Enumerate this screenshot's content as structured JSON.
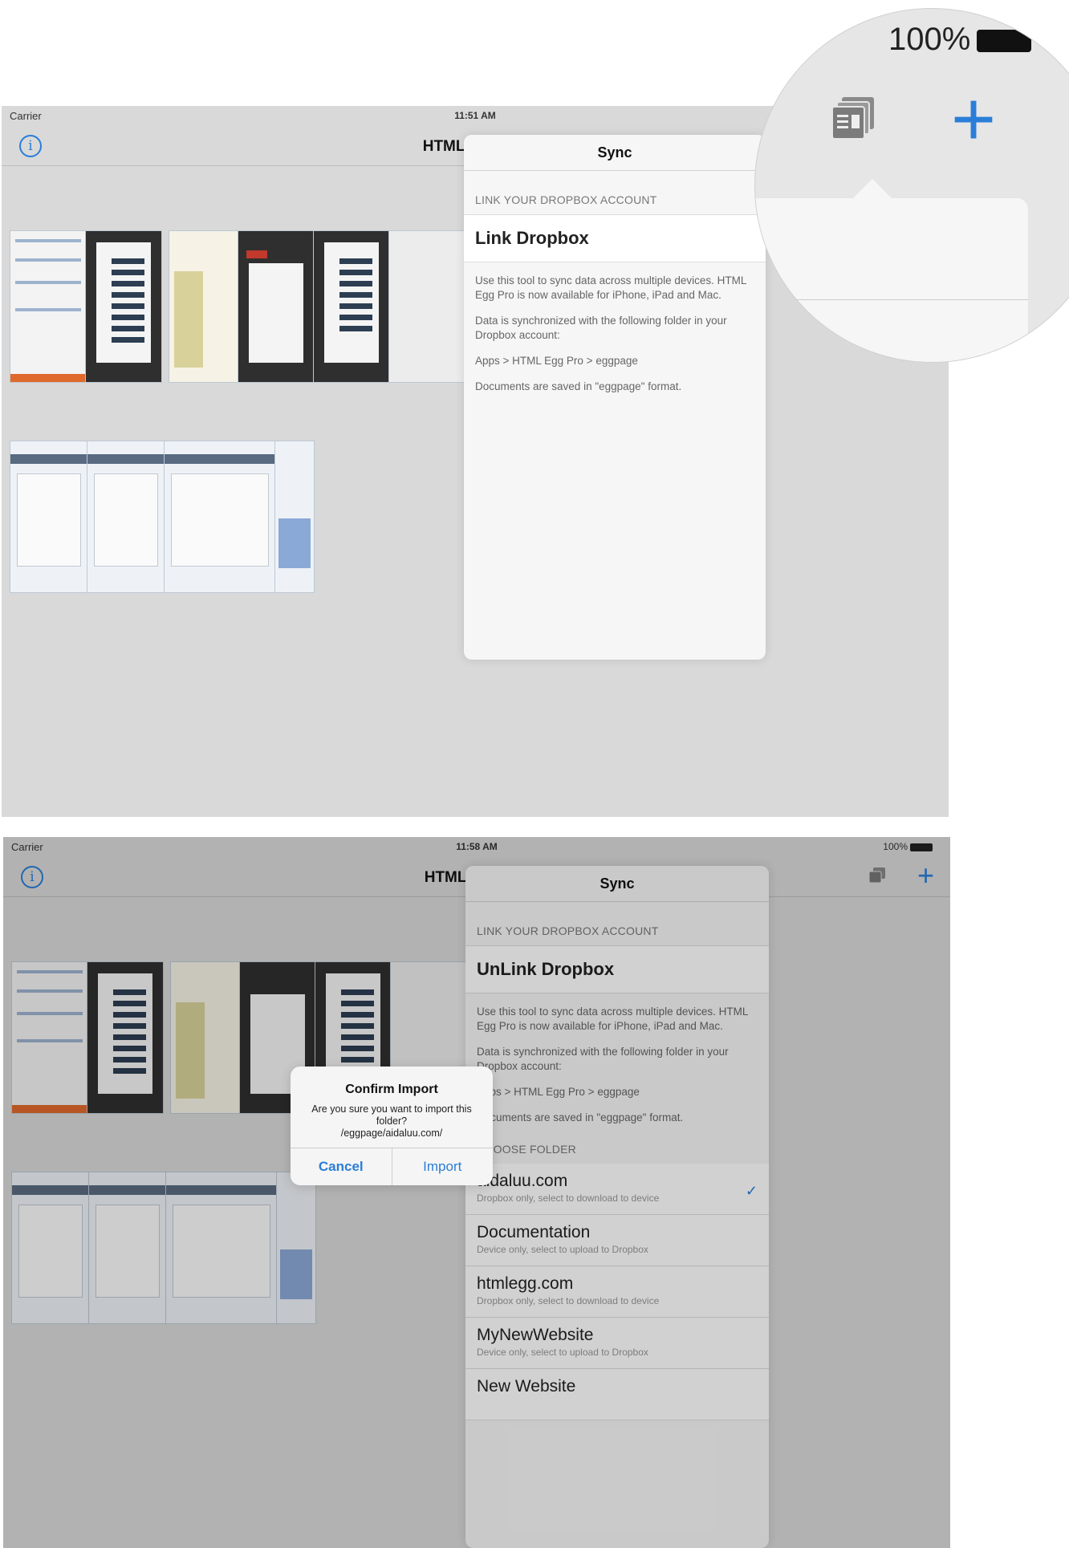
{
  "screen1": {
    "status": {
      "carrier": "Carrier",
      "time": "11:51 AM"
    },
    "nav_title": "HTML Egg Pro",
    "popover": {
      "title": "Sync",
      "section_header": "LINK YOUR DROPBOX ACCOUNT",
      "link_label": "Link Dropbox",
      "descriptions": [
        "Use this tool to sync data across multiple devices. HTML Egg Pro is now available for iPhone, iPad and Mac.",
        "Data is synchronized with the following folder in your Dropbox account:",
        "Apps > HTML Egg Pro > eggpage",
        "Documents are saved in \"eggpage\" format."
      ]
    },
    "magnifier": {
      "battery": "100%"
    }
  },
  "screen2": {
    "status": {
      "carrier": "Carrier",
      "time": "11:58 AM",
      "battery": "100%"
    },
    "nav_title": "HTML Egg Pro",
    "popover": {
      "title": "Sync",
      "section_header": "LINK YOUR DROPBOX ACCOUNT",
      "link_label": "UnLink Dropbox",
      "descriptions": [
        "Use this tool to sync data across multiple devices. HTML Egg Pro is now available for iPhone, iPad and Mac.",
        "Data is synchronized with the following folder in your Dropbox account:",
        "Apps > HTML Egg Pro > eggpage",
        "Documents are saved in \"eggpage\" format."
      ],
      "folder_header": "CHOOSE FOLDER",
      "folders": [
        {
          "name": "aidaluu.com",
          "sub": "Dropbox only, select to download to device",
          "checked": "✓"
        },
        {
          "name": "Documentation",
          "sub": "Device only, select to upload to Dropbox",
          "checked": ""
        },
        {
          "name": "htmlegg.com",
          "sub": "Dropbox only, select to download to device",
          "checked": ""
        },
        {
          "name": "MyNewWebsite",
          "sub": "Device only, select to upload to Dropbox",
          "checked": ""
        },
        {
          "name": "New Website",
          "sub": "",
          "checked": ""
        }
      ]
    },
    "alert": {
      "title": "Confirm Import",
      "message": "Are you sure you want to import this folder?\n/eggpage/aidaluu.com/",
      "cancel": "Cancel",
      "import": "Import"
    }
  },
  "colors": {
    "accent": "#2a7ed8",
    "background": "#d9d9d9"
  }
}
